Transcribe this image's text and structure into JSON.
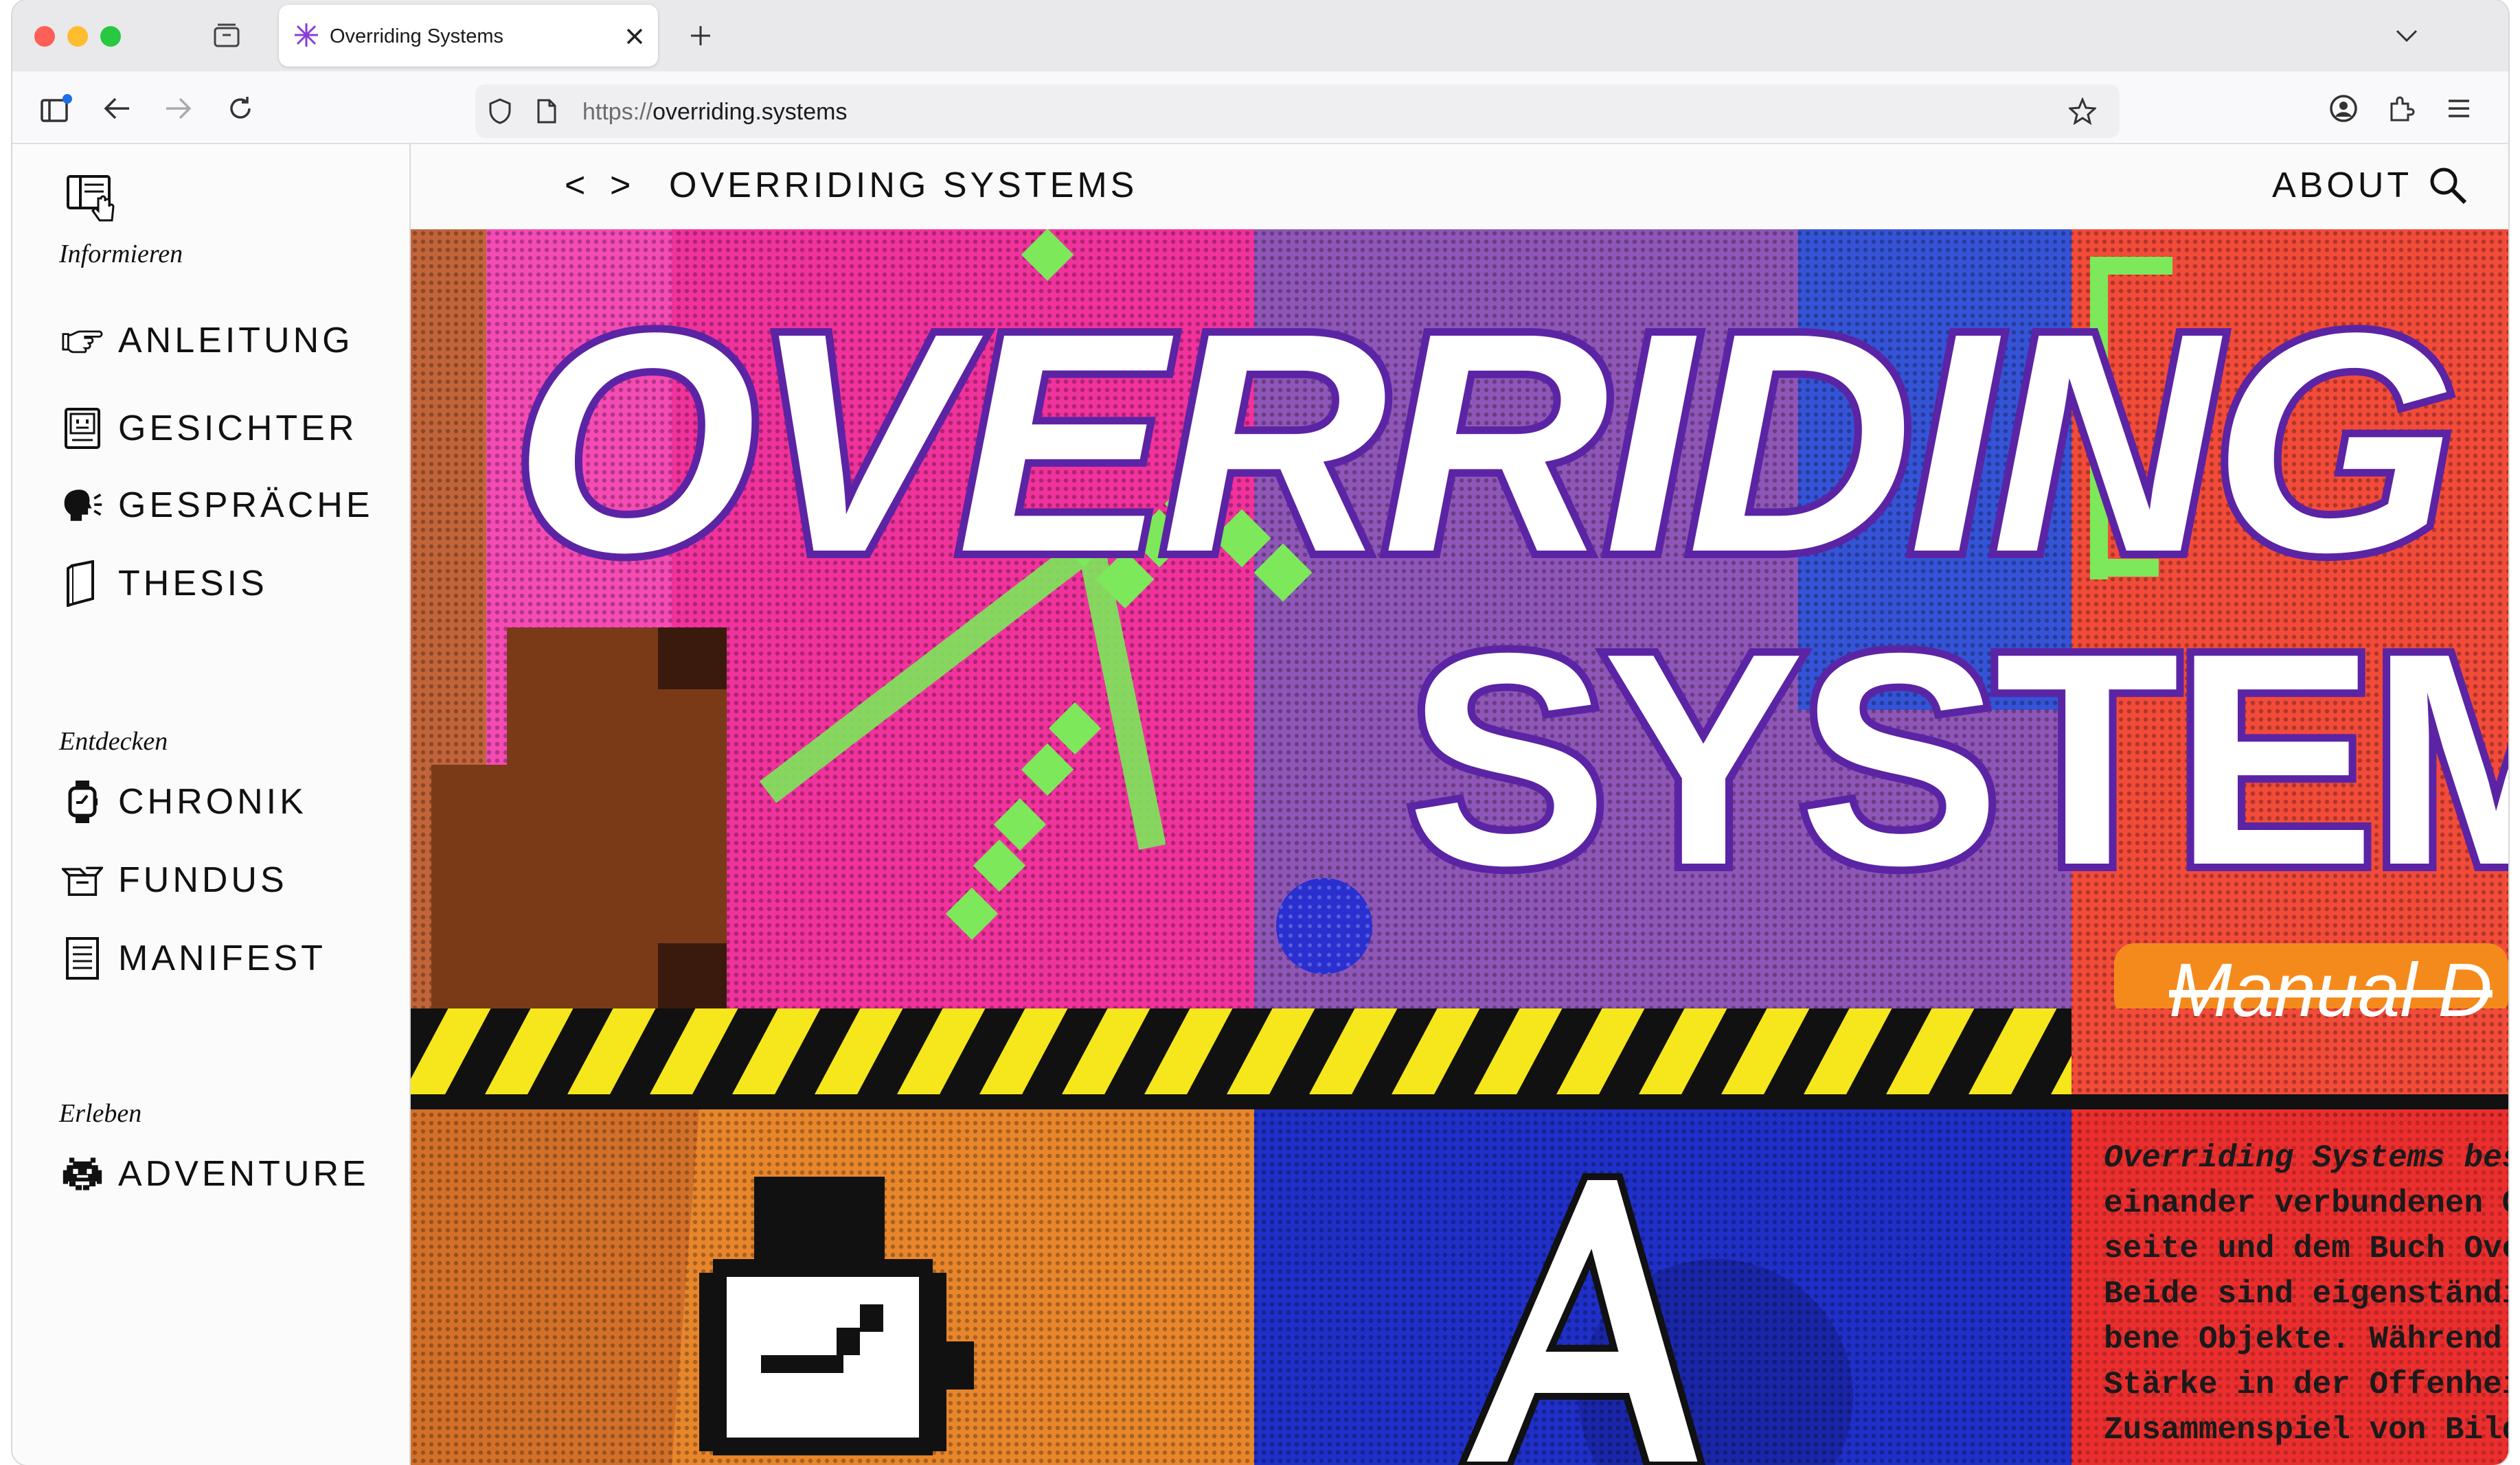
{
  "browser": {
    "tab_title": "Overriding Systems",
    "tab_icon": "asterisk-icon",
    "url_scheme": "https://",
    "url_host": "overriding.systems"
  },
  "sidebar": {
    "sections": [
      {
        "title": "Informieren",
        "items": [
          {
            "label": "ANLEITUNG",
            "icon": "pointing-hand-icon"
          },
          {
            "label": "GESICHTER",
            "icon": "computer-face-icon"
          },
          {
            "label": "GESPRÄCHE",
            "icon": "speaking-head-icon"
          },
          {
            "label": "THESIS",
            "icon": "book-icon"
          }
        ]
      },
      {
        "title": "Entdecken",
        "items": [
          {
            "label": "CHRONIK",
            "icon": "watch-icon"
          },
          {
            "label": "FUNDUS",
            "icon": "box-icon"
          },
          {
            "label": "MANIFEST",
            "icon": "document-icon"
          }
        ]
      },
      {
        "title": "Erleben",
        "items": [
          {
            "label": "ADVENTURE",
            "icon": "space-invader-icon"
          }
        ]
      }
    ]
  },
  "topbar": {
    "back": "<",
    "forward": ">",
    "site_title": "OVERRIDING SYSTEMS",
    "about": "ABOUT"
  },
  "hero": {
    "line1": "OVERRIDING",
    "line2": "SYSTEM",
    "tag": "Manual D",
    "intro_lines": [
      "Overriding Systems best",
      "einander verbundenen Ob",
      "seite und dem Buch Over",
      "Beide sind eigenständig",
      "bene Objekte. Während d",
      "Stärke in der Offenheit",
      "Zusammenspiel von Bild"
    ]
  },
  "colors": {
    "purple_stroke": "#5b24a4",
    "hazard_yellow": "#f6e61c",
    "pink": "#f0329d",
    "orange": "#e8862c",
    "blue": "#1f2fc8",
    "red": "#ea2e2e",
    "green": "#7ce85a"
  }
}
